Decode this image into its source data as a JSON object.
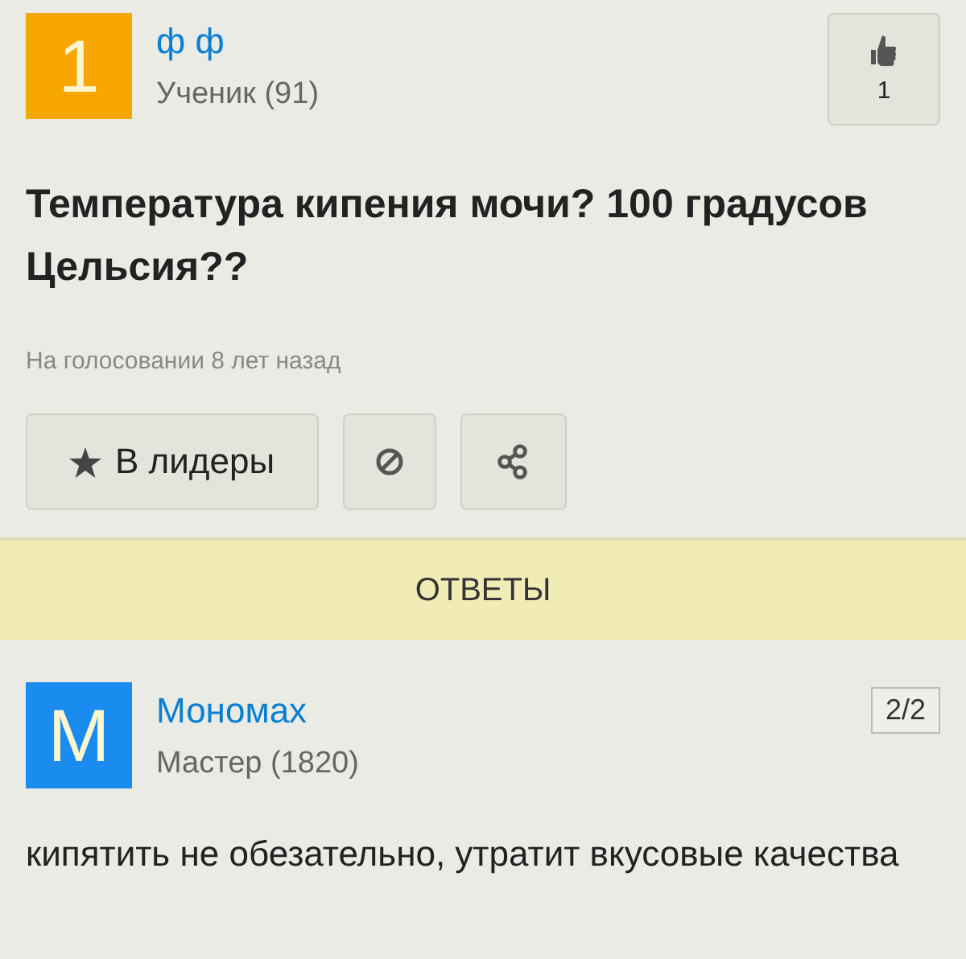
{
  "question": {
    "avatar": {
      "letter": "1",
      "color": "#f7a600"
    },
    "author": "ф ф",
    "rank": "Ученик (91)",
    "likes": "1",
    "title": "Температура кипения мочи? 100 градусов Цельсия??",
    "meta": "На голосовании 8 лет назад",
    "leader_button": "В лидеры"
  },
  "answers_header": "ОТВЕТЫ",
  "answers": [
    {
      "avatar": {
        "letter": "М",
        "color": "#1a8cf0"
      },
      "author": "Мономах",
      "rank": "Мастер (1820)",
      "counter": "2/2",
      "text": "кипятить не обезательно, утратит вкусовые качества"
    }
  ]
}
